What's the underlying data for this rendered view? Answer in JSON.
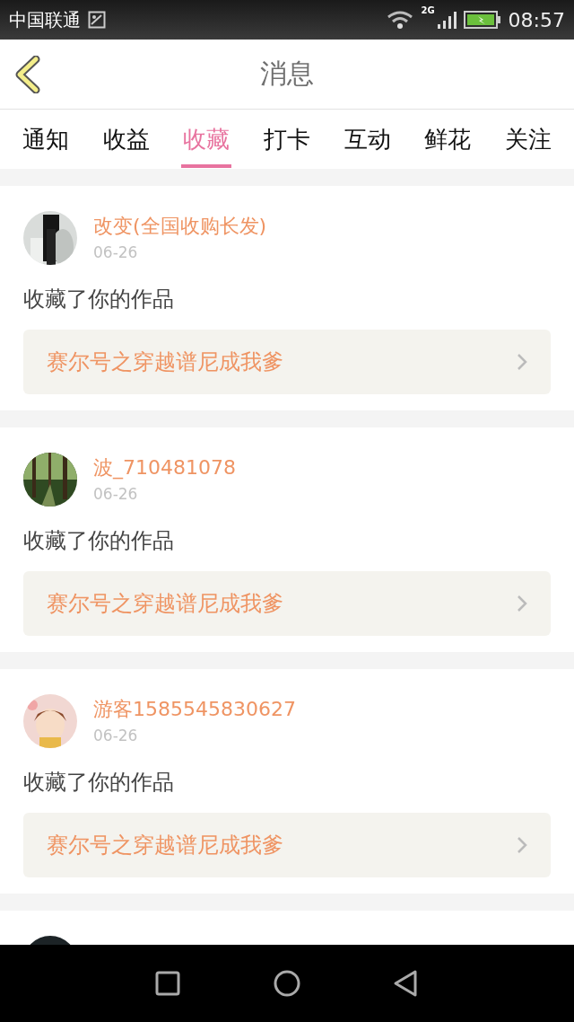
{
  "status_bar": {
    "carrier": "中国联通",
    "network": "2G",
    "time": "08:57"
  },
  "header": {
    "title": "消息"
  },
  "tabs": [
    {
      "label": "通知",
      "selected": false
    },
    {
      "label": "收益",
      "selected": false
    },
    {
      "label": "收藏",
      "selected": true
    },
    {
      "label": "打卡",
      "selected": false
    },
    {
      "label": "互动",
      "selected": false
    },
    {
      "label": "鲜花",
      "selected": false
    },
    {
      "label": "关注",
      "selected": false
    }
  ],
  "messages": [
    {
      "kind": "message",
      "user": "改变(全国收购长发)",
      "date": "06-26",
      "action": "收藏了你的作品",
      "work": "赛尔号之穿越谱尼成我爹"
    },
    {
      "kind": "message",
      "user": "波_710481078",
      "date": "06-26",
      "action": "收藏了你的作品",
      "work": "赛尔号之穿越谱尼成我爹"
    },
    {
      "kind": "message",
      "user": "游客1585545830627",
      "date": "06-26",
      "action": "收藏了你的作品",
      "work": "赛尔号之穿越谱尼成我爹"
    },
    {
      "kind": "cut_off"
    }
  ]
}
